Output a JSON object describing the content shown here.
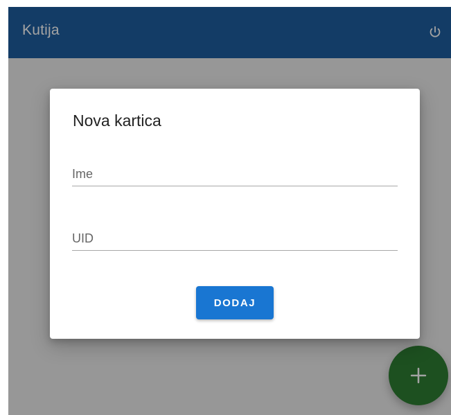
{
  "app": {
    "title": "Kutija",
    "power_icon": "power-icon",
    "colors": {
      "app_bar": "#1f5fa0",
      "background": "#ececec",
      "primary_button": "#1976d2",
      "fab": "#2e7d32"
    }
  },
  "dialog": {
    "title": "Nova kartica",
    "fields": [
      {
        "placeholder": "Ime",
        "value": ""
      },
      {
        "placeholder": "UID",
        "value": ""
      }
    ],
    "submit_label": "DODAJ"
  },
  "fab": {
    "icon": "plus-icon"
  }
}
